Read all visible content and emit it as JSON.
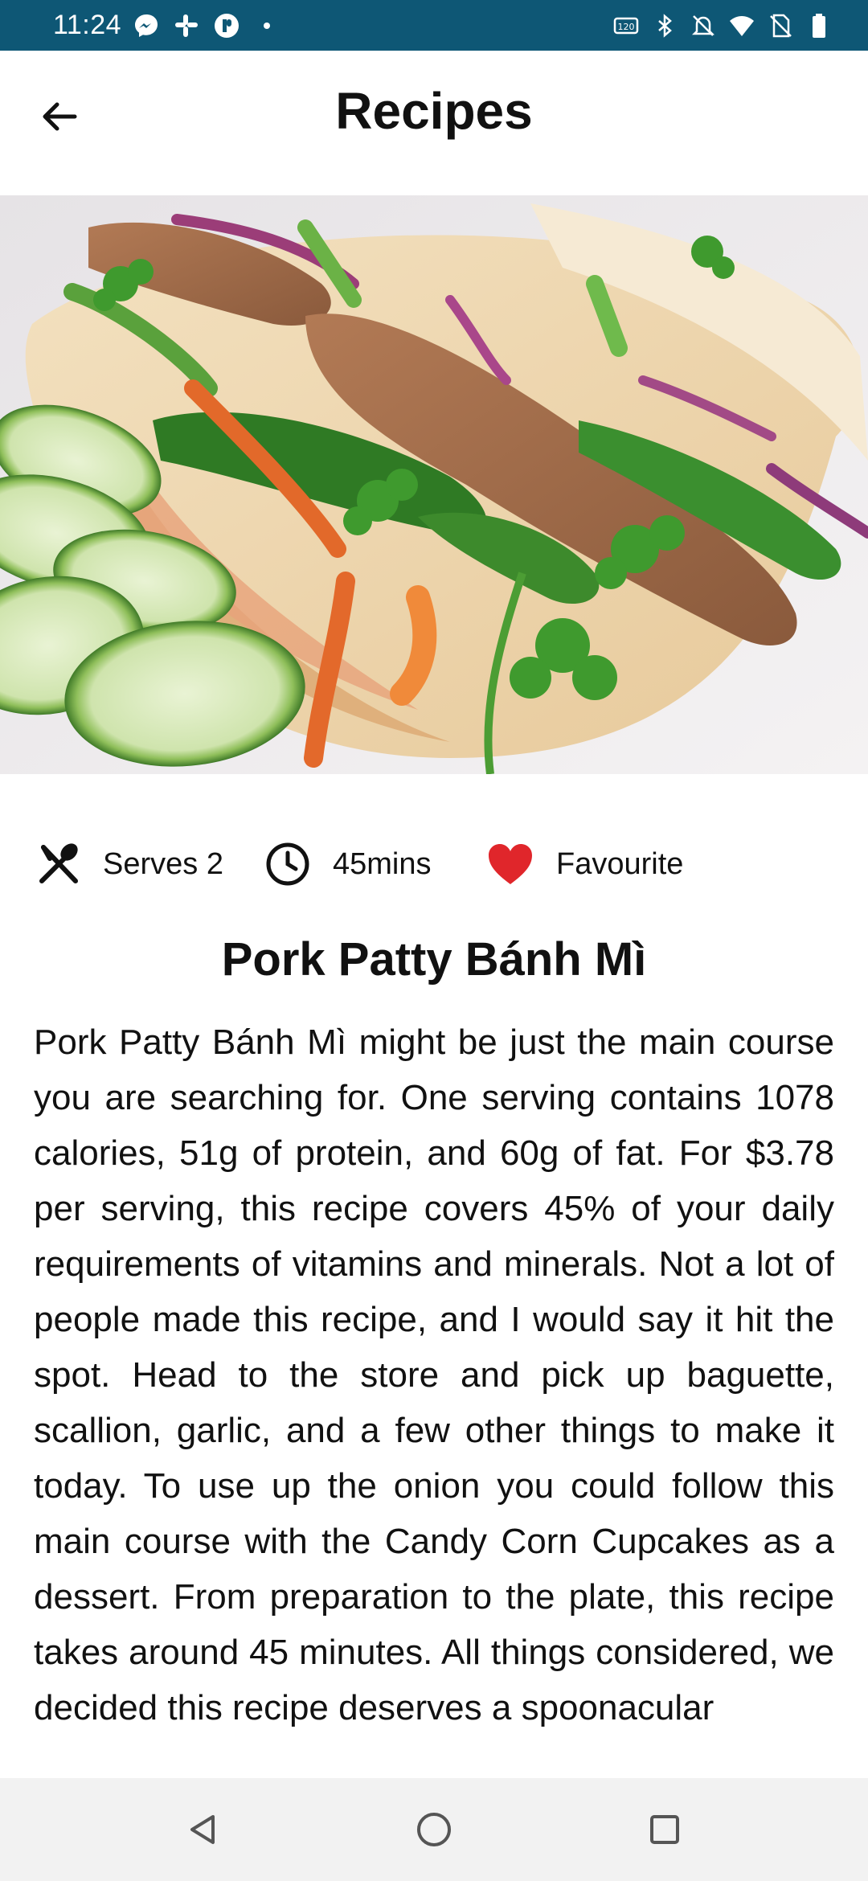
{
  "status_bar": {
    "time": "11:24",
    "left_icons": [
      "messenger-icon",
      "slack-icon",
      "pocket-casts-icon",
      "dot-icon"
    ],
    "right_icons": [
      "hd-voice-icon",
      "bluetooth-icon",
      "mute-icon",
      "wifi-icon",
      "no-sim-icon",
      "battery-icon"
    ]
  },
  "app_bar": {
    "title": "Recipes",
    "back_icon": "arrow-left-icon"
  },
  "recipe": {
    "image_alt": "pork-patty-banh-mi-photo",
    "serves_label": "Serves 2",
    "time_label": "45mins",
    "favourite_label": "Favourite",
    "title": "Pork Patty Bánh Mì",
    "description": "Pork Patty Bánh Mì might be just the main course you are searching for. One serving contains 1078 calories, 51g of protein, and 60g of fat. For $3.78 per serving, this recipe covers 45% of your daily requirements of vitamins and minerals. Not a lot of people made this recipe, and I would say it hit the spot. Head to the store and pick up baguette, scallion, garlic, and a few other things to make it today. To use up the onion you could follow this main course with the Candy Corn Cupcakes as a dessert. From preparation to the plate, this recipe takes around 45 minutes. All things considered, we decided this recipe deserves a spoonacular"
  },
  "nav_bar": {
    "buttons": [
      "back-triangle-icon",
      "home-circle-icon",
      "recents-square-icon"
    ]
  },
  "colors": {
    "status_bar": "#0e5775",
    "favourite_heart": "#e0262b",
    "nav_bar_bg": "#f2f2f2",
    "text": "#111111"
  }
}
